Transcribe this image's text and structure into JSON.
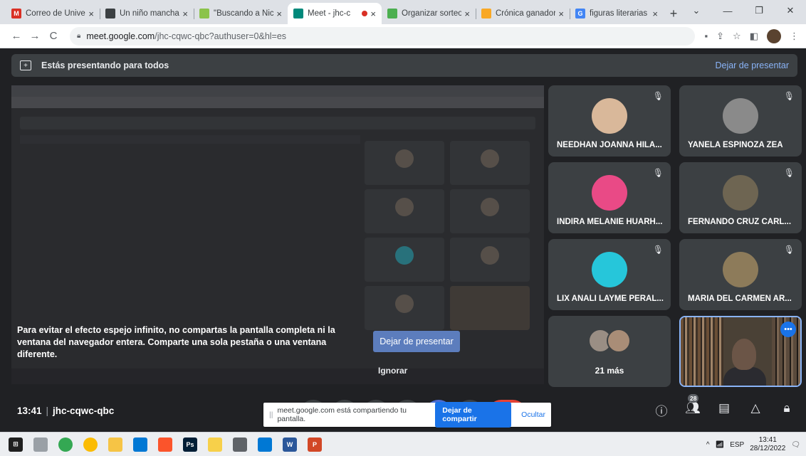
{
  "browser": {
    "tabs": [
      {
        "title": "Correo de Univer",
        "favicon": "gmail-icon",
        "color": "#d93025",
        "glyph": "M",
        "active": false
      },
      {
        "title": "Un niño manchad",
        "favicon": "page-icon",
        "color": "#3c4043",
        "glyph": "",
        "active": false
      },
      {
        "title": "\"Buscando a Nic",
        "favicon": "page-icon",
        "color": "#8bc34a",
        "glyph": "",
        "active": false
      },
      {
        "title": "Meet - jhc-c",
        "favicon": "meet-icon",
        "color": "#00897b",
        "glyph": "",
        "active": true,
        "recording": true
      },
      {
        "title": "Organizar sorteo",
        "favicon": "page-icon",
        "color": "#4caf50",
        "glyph": "",
        "active": false
      },
      {
        "title": "Crónica ganador",
        "favicon": "page-icon",
        "color": "#f9a825",
        "glyph": "",
        "active": false
      },
      {
        "title": "figuras literarias",
        "favicon": "google-icon",
        "color": "#4285f4",
        "glyph": "G",
        "active": false
      }
    ],
    "url_host": "meet.google.com",
    "url_path": "/jhc-cqwc-qbc?authuser=0&hl=es"
  },
  "presenting_bar": {
    "text": "Estás presentando para todos",
    "stop_label": "Dejar de presentar"
  },
  "share_overlay": {
    "message": "Para evitar el efecto espejo infinito, no compartas la pantalla completa ni la ventana del navegador entera. Comparte una sola pestaña o una ventana diferente.",
    "stop_label": "Dejar de presentar",
    "ignore_label": "Ignorar"
  },
  "participants": [
    {
      "name": "NEEDHAN JOANNA HILA...",
      "avatar_color": "#d9b89a"
    },
    {
      "name": "YANELA ESPINOZA ZEA",
      "avatar_color": "#8a8a8a"
    },
    {
      "name": "INDIRA MELANIE HUARH...",
      "avatar_color": "#e94a86"
    },
    {
      "name": "FERNANDO CRUZ CARL...",
      "avatar_color": "#6e6552"
    },
    {
      "name": "LIX ANALI LAYME PERAL...",
      "avatar_color": "#26c6da"
    },
    {
      "name": "MARIA DEL CARMEN AR...",
      "avatar_color": "#8d7b5a"
    }
  ],
  "more": {
    "label": "21 más"
  },
  "meeting": {
    "time": "13:41",
    "code": "jhc-cqwc-qbc",
    "people_count": "28"
  },
  "share_notice": {
    "text": "meet.google.com está compartiendo tu pantalla.",
    "stop_label": "Dejar de compartir",
    "hide_label": "Ocultar"
  },
  "taskbar": {
    "language": "ESP",
    "clock_time": "13:41",
    "clock_date": "28/12/2022"
  }
}
